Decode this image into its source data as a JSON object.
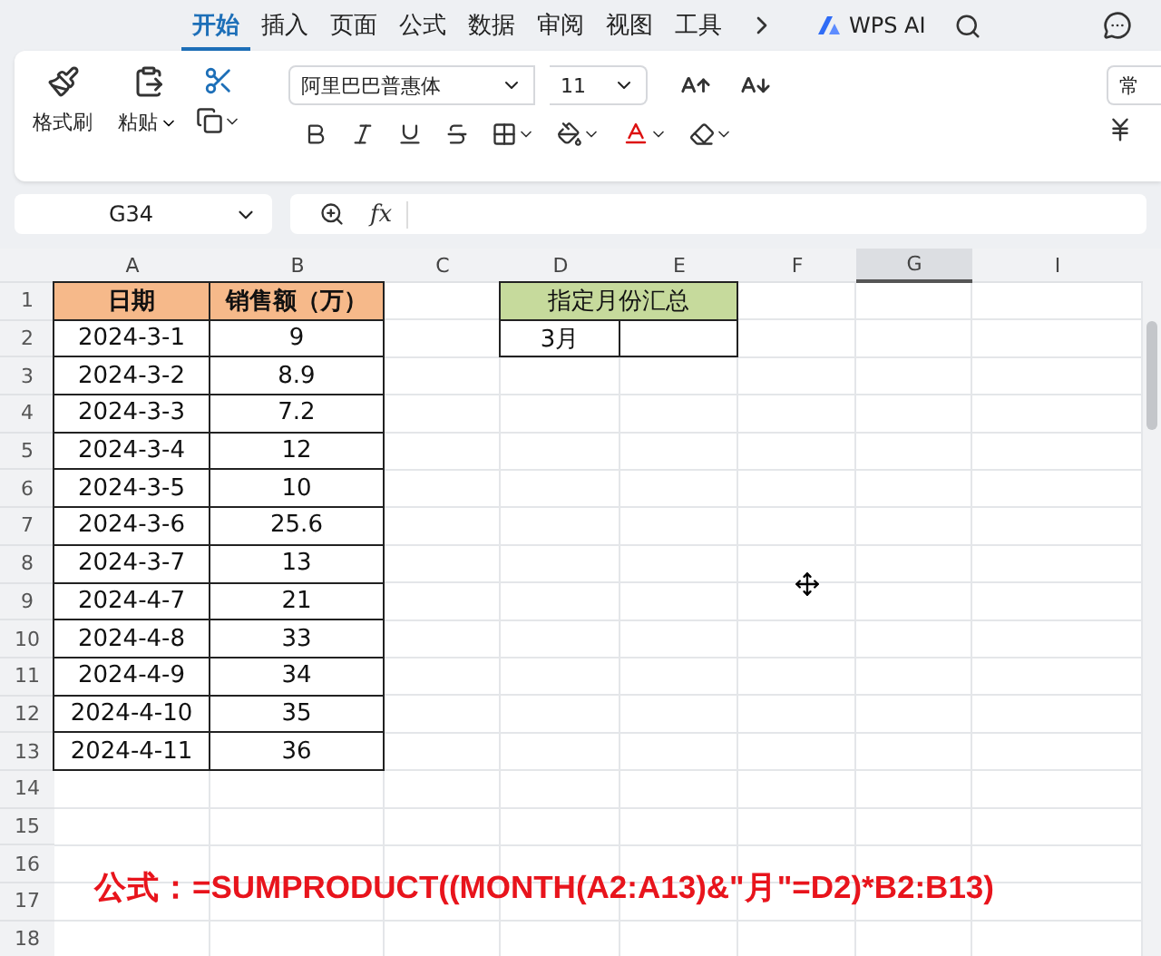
{
  "tabs": [
    {
      "label": "开始",
      "selected": true
    },
    {
      "label": "插入",
      "selected": false
    },
    {
      "label": "页面",
      "selected": false
    },
    {
      "label": "公式",
      "selected": false
    },
    {
      "label": "数据",
      "selected": false
    },
    {
      "label": "审阅",
      "selected": false
    },
    {
      "label": "视图",
      "selected": false
    },
    {
      "label": "工具",
      "selected": false
    }
  ],
  "ai_button": {
    "label": "WPS AI"
  },
  "ribbon": {
    "format_painter": "格式刷",
    "paste": "粘贴",
    "font": "阿里巴巴普惠体",
    "font_size": "11",
    "number_format": "常"
  },
  "name_box": "G34",
  "formula_bar": {
    "fx": "fx"
  },
  "columns": [
    {
      "label": "A",
      "selected": false
    },
    {
      "label": "B",
      "selected": false
    },
    {
      "label": "C",
      "selected": false
    },
    {
      "label": "D",
      "selected": false
    },
    {
      "label": "E",
      "selected": false
    },
    {
      "label": "F",
      "selected": false
    },
    {
      "label": "G",
      "selected": true
    },
    {
      "label": "I",
      "selected": false
    }
  ],
  "row_numbers": [
    "1",
    "2",
    "3",
    "4",
    "5",
    "6",
    "7",
    "8",
    "9",
    "10",
    "11",
    "12",
    "13",
    "14",
    "15",
    "16",
    "17",
    "18"
  ],
  "sales_table": {
    "headers": [
      "日期",
      "销售额（万）"
    ],
    "rows": [
      [
        "2024-3-1",
        "9"
      ],
      [
        "2024-3-2",
        "8.9"
      ],
      [
        "2024-3-3",
        "7.2"
      ],
      [
        "2024-3-4",
        "12"
      ],
      [
        "2024-3-5",
        "10"
      ],
      [
        "2024-3-6",
        "25.6"
      ],
      [
        "2024-3-7",
        "13"
      ],
      [
        "2024-4-7",
        "21"
      ],
      [
        "2024-4-8",
        "33"
      ],
      [
        "2024-4-9",
        "34"
      ],
      [
        "2024-4-10",
        "35"
      ],
      [
        "2024-4-11",
        "36"
      ]
    ]
  },
  "summary": {
    "title": "指定月份汇总",
    "month": "3月"
  },
  "formula_note": "公式：=SUMPRODUCT((MONTH(A2:A13)&\"月\"=D2)*B2:B13)"
}
